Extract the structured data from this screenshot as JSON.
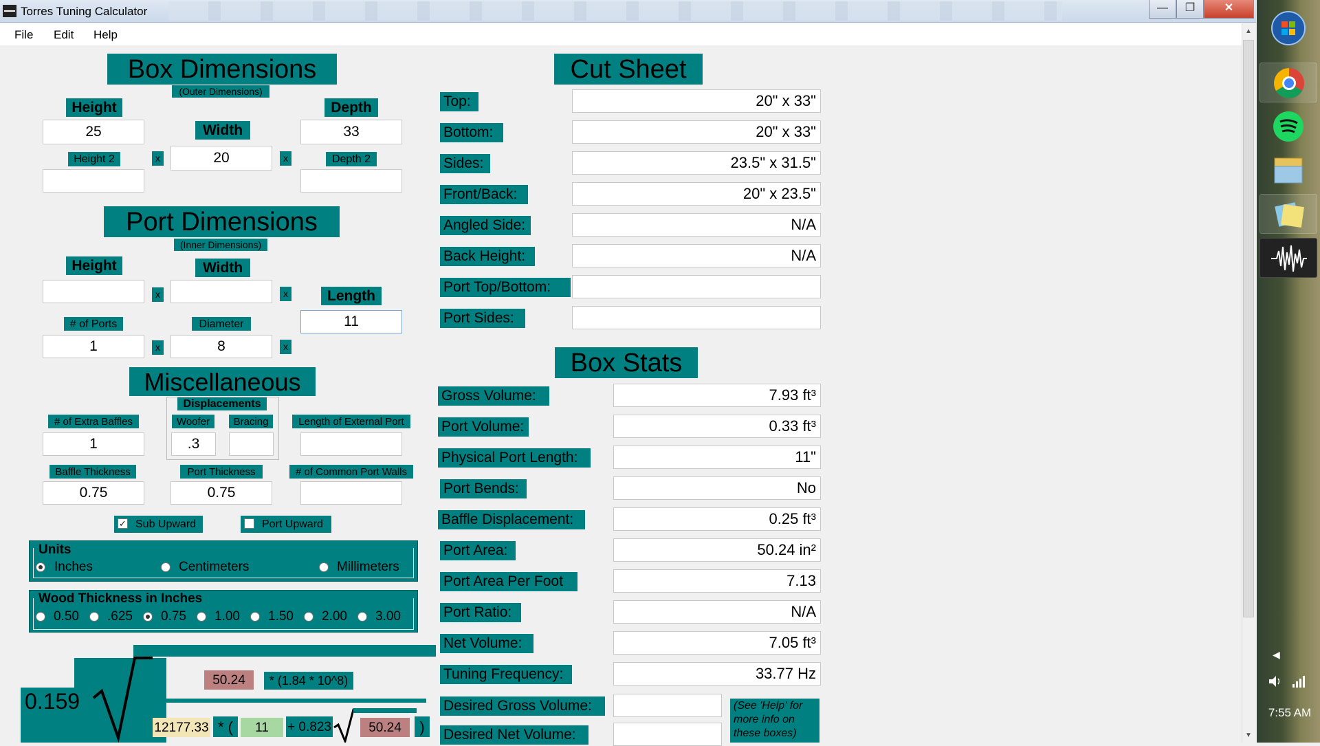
{
  "window": {
    "title": "Torres Tuning Calculator",
    "min": "—",
    "max": "❐",
    "close": "✕"
  },
  "menu": [
    "File",
    "Edit",
    "Help"
  ],
  "box": {
    "title": "Box Dimensions",
    "subtitle": "(Outer Dimensions)",
    "height_label": "Height",
    "width_label": "Width",
    "depth_label": "Depth",
    "height2_label": "Height 2",
    "depth2_label": "Depth 2",
    "height": "25",
    "width": "20",
    "depth": "33",
    "height2": "",
    "depth2": "",
    "x": "x"
  },
  "port": {
    "title": "Port Dimensions",
    "subtitle": "(Inner Dimensions)",
    "height_label": "Height",
    "width_label": "Width",
    "length_label": "Length",
    "ports_label": "# of Ports",
    "diameter_label": "Diameter",
    "height": "",
    "width": "",
    "length": "11",
    "ports": "1",
    "diameter": "8"
  },
  "misc": {
    "title": "Miscellaneous",
    "displacements_label": "Displacements",
    "baffles_label": "# of Extra Baffles",
    "woofer_label": "Woofer",
    "bracing_label": "Bracing",
    "ext_port_label": "Length of External Port",
    "baffle_thick_label": "Baffle Thickness",
    "port_thick_label": "Port Thickness",
    "common_walls_label": "# of Common Port Walls",
    "baffles": "1",
    "woofer": ".3",
    "bracing": "",
    "ext_port": "",
    "baffle_thick": "0.75",
    "port_thick": "0.75",
    "common_walls": "",
    "sub_upward": "Sub Upward",
    "port_upward": "Port Upward"
  },
  "units": {
    "title": "Units",
    "options": [
      "Inches",
      "Centimeters",
      "Millimeters"
    ],
    "selected": "Inches"
  },
  "wood": {
    "title": "Wood Thickness in Inches",
    "options": [
      "0.50",
      ".625",
      "0.75",
      "1.00",
      "1.50",
      "2.00",
      "3.00"
    ],
    "selected": "0.75"
  },
  "cut": {
    "title": "Cut Sheet",
    "rows": [
      {
        "label": "Top:",
        "value": "20\" x 33\""
      },
      {
        "label": "Bottom:",
        "value": "20\" x 33\""
      },
      {
        "label": "Sides:",
        "value": "23.5\" x 31.5\""
      },
      {
        "label": "Front/Back:",
        "value": "20\" x 23.5\""
      },
      {
        "label": "Angled Side:",
        "value": "N/A"
      },
      {
        "label": "Back Height:",
        "value": "N/A"
      },
      {
        "label": "Port Top/Bottom:",
        "value": ""
      },
      {
        "label": "Port Sides:",
        "value": ""
      }
    ]
  },
  "stats": {
    "title": "Box Stats",
    "rows": [
      {
        "label": "Gross Volume:",
        "value": "7.93 ft³"
      },
      {
        "label": "Port Volume:",
        "value": "0.33 ft³"
      },
      {
        "label": "Physical Port Length:",
        "value": "11\""
      },
      {
        "label": "Port Bends:",
        "value": "No"
      },
      {
        "label": "Baffle Displacement:",
        "value": "0.25 ft³"
      },
      {
        "label": "Port Area:",
        "value": "50.24 in²"
      },
      {
        "label": "Port Area Per Foot",
        "value": "7.13"
      },
      {
        "label": "Port Ratio:",
        "value": "N/A"
      },
      {
        "label": "Net Volume:",
        "value": "7.05 ft³"
      },
      {
        "label": "Tuning Frequency:",
        "value": "33.77 Hz"
      }
    ],
    "desired_gross": "Desired Gross Volume:",
    "desired_net": "Desired Net Volume:",
    "help_note": "(See 'Help' for more info on these boxes)"
  },
  "formula": {
    "coef": "0.159",
    "area": "50.24",
    "factor": "* (1.84 * 10^8)",
    "volume": "12177.33",
    "mult_open": "* (",
    "length": "11",
    "plus": "+ 0.823",
    "area2": "50.24",
    "close": ")"
  },
  "taskbar": {
    "time": "7:55 AM",
    "icons": [
      "start-orb-icon",
      "chrome-icon",
      "spotify-icon",
      "folder-icon",
      "sticky-notes-icon",
      "audio-wave-icon"
    ]
  }
}
